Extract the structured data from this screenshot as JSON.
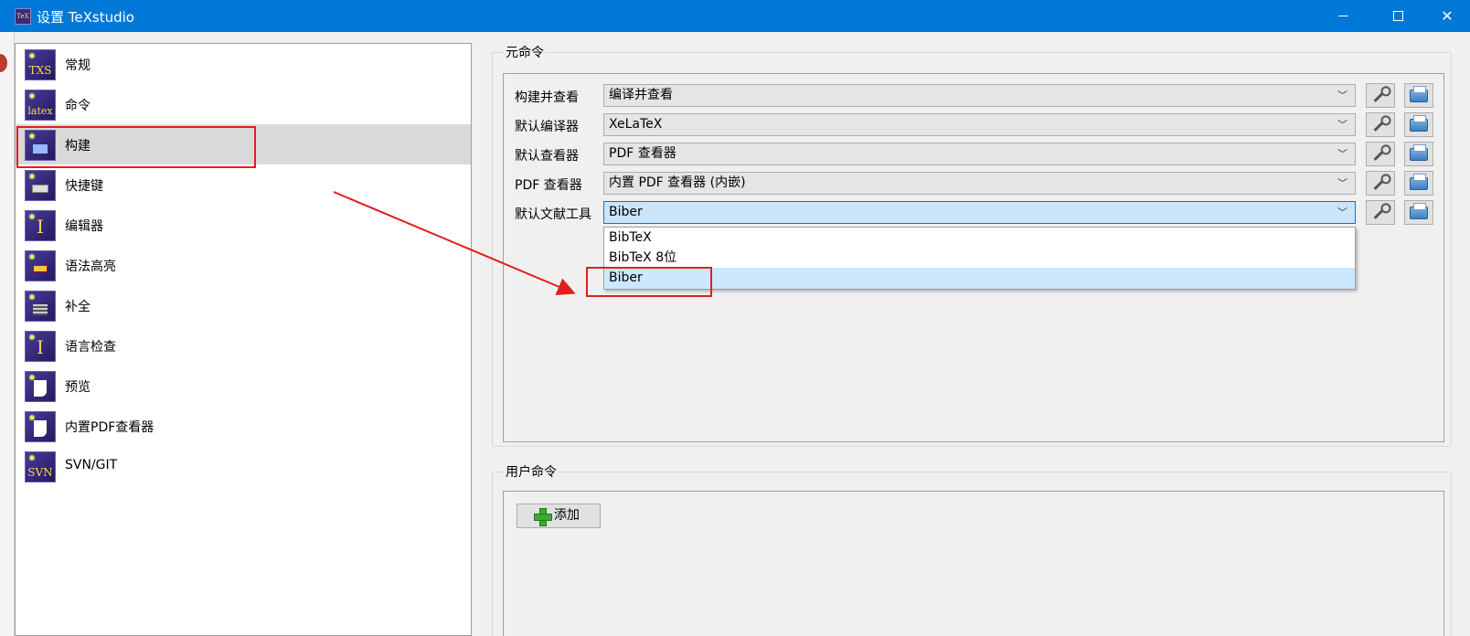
{
  "window": {
    "title": "设置 TeXstudio",
    "app_icon_text": "TeX"
  },
  "nav": {
    "items": [
      {
        "label": "常规",
        "icon": "txs-icon",
        "icon_text": "TXS"
      },
      {
        "label": "命令",
        "icon": "latex-icon",
        "icon_text": "latex"
      },
      {
        "label": "构建",
        "icon": "build-icon",
        "icon_text": "",
        "selected": true
      },
      {
        "label": "快捷键",
        "icon": "keyboard-icon",
        "icon_text": ""
      },
      {
        "label": "编辑器",
        "icon": "cursor-icon",
        "icon_text": "I"
      },
      {
        "label": "语法高亮",
        "icon": "highlight-icon",
        "icon_text": ""
      },
      {
        "label": "补全",
        "icon": "completion-icon",
        "icon_text": ""
      },
      {
        "label": "语言检查",
        "icon": "spellcheck-icon",
        "icon_text": "I"
      },
      {
        "label": "预览",
        "icon": "preview-icon",
        "icon_text": ""
      },
      {
        "label": "内置PDF查看器",
        "icon": "pdf-viewer-icon",
        "icon_text": ""
      },
      {
        "label": "SVN/GIT",
        "icon": "svn-icon",
        "icon_text": "SVN"
      }
    ]
  },
  "meta_commands": {
    "legend": "元命令",
    "rows": [
      {
        "label": "构建并查看",
        "value": "编译并查看"
      },
      {
        "label": "默认编译器",
        "value": "XeLaTeX"
      },
      {
        "label": "默认查看器",
        "value": "PDF 查看器"
      },
      {
        "label": "PDF 查看器",
        "value": "内置 PDF 查看器 (内嵌)"
      },
      {
        "label": "默认文献工具",
        "value": "Biber"
      }
    ],
    "dropdown_options": [
      "BibTeX",
      "BibTeX 8位",
      "Biber"
    ],
    "dropdown_selected": "Biber"
  },
  "user_commands": {
    "legend": "用户命令",
    "add_label": "添加"
  },
  "colors": {
    "titlebar": "#0078d7",
    "annotation": "#e02020",
    "selection": "#cce8ff"
  }
}
